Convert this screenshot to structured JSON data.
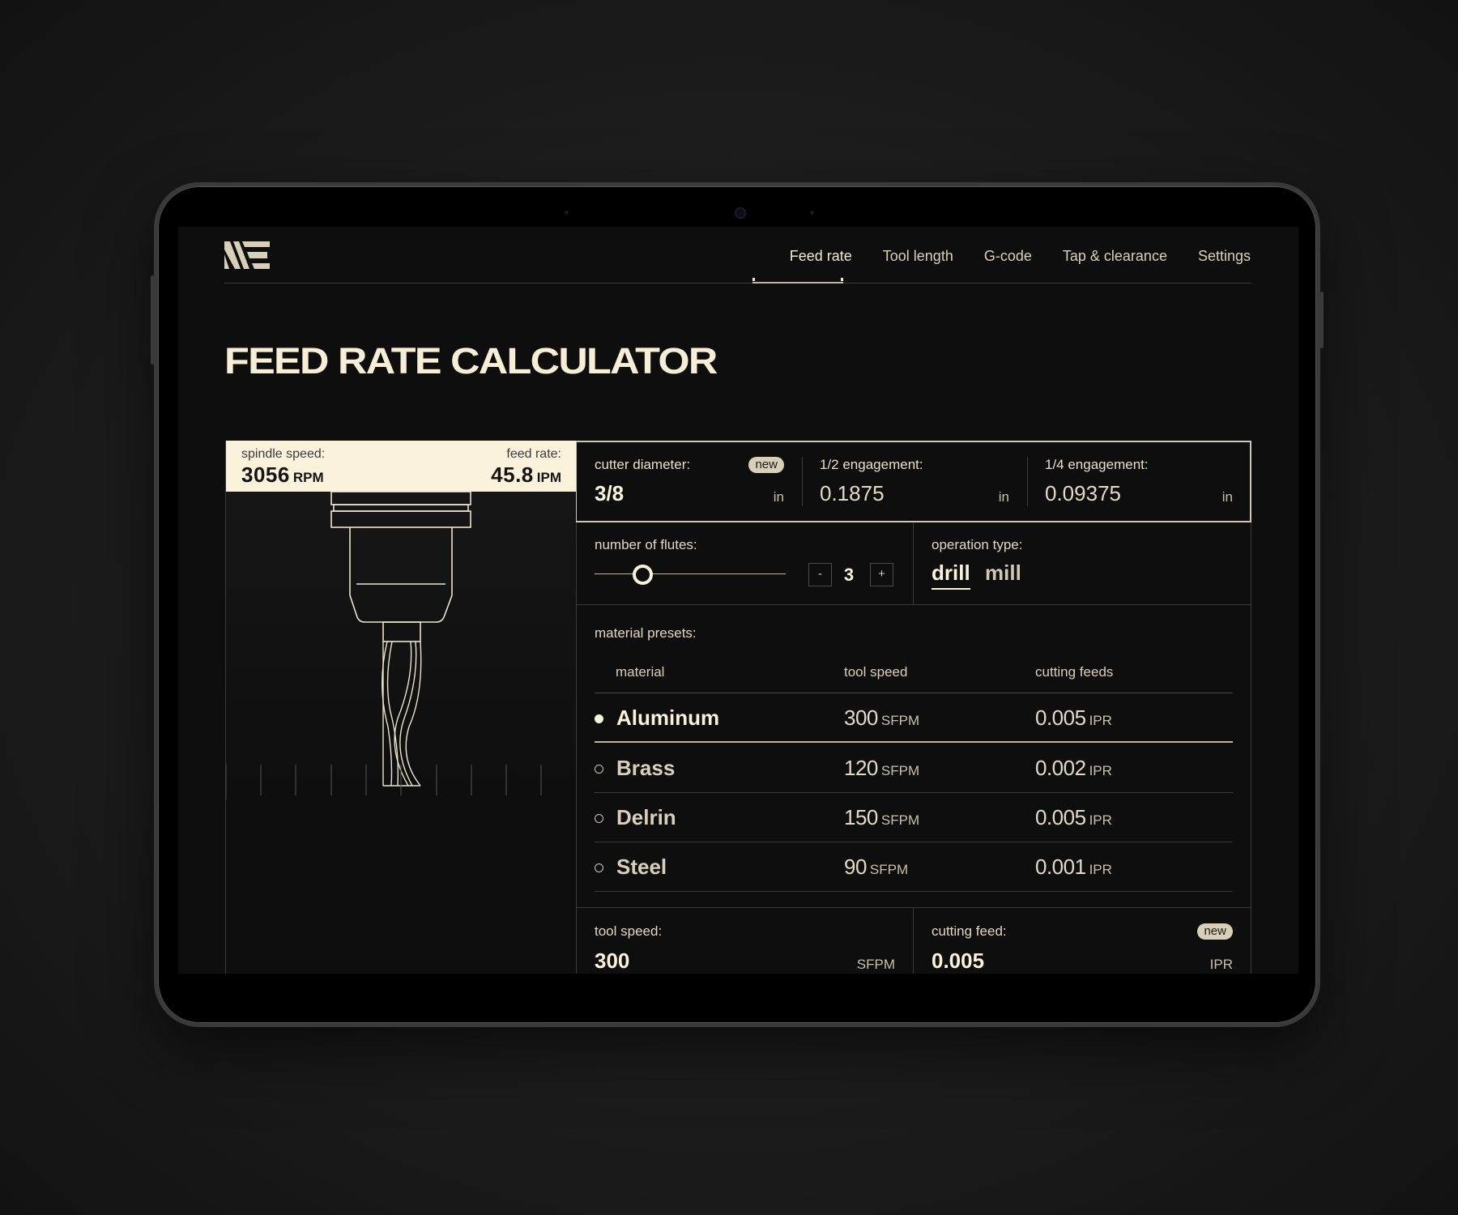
{
  "nav": {
    "items": [
      {
        "label": "Feed rate",
        "active": true
      },
      {
        "label": "Tool length",
        "active": false
      },
      {
        "label": "G-code",
        "active": false
      },
      {
        "label": "Tap & clearance",
        "active": false
      },
      {
        "label": "Settings",
        "active": false
      }
    ]
  },
  "page": {
    "title": "FEED RATE CALCULATOR"
  },
  "readout": {
    "spindle_label": "spindle speed:",
    "spindle_value": "3056",
    "spindle_unit": "RPM",
    "feed_label": "feed rate:",
    "feed_value": "45.8",
    "feed_unit": "IPM"
  },
  "inputs": {
    "cutter_diameter": {
      "label": "cutter diameter:",
      "value": "3/8",
      "unit": "in",
      "badge": "new"
    },
    "half_engagement": {
      "label": "1/2 engagement:",
      "value": "0.1875",
      "unit": "in"
    },
    "quarter_engagement": {
      "label": "1/4 engagement:",
      "value": "0.09375",
      "unit": "in"
    },
    "flutes": {
      "label": "number of flutes:",
      "value": "3",
      "minus": "-",
      "plus": "+",
      "slider_fraction": 0.25
    },
    "operation": {
      "label": "operation type:",
      "options": [
        "drill",
        "mill"
      ],
      "selected": "drill"
    }
  },
  "presets": {
    "label": "material presets:",
    "columns": [
      "material",
      "tool speed",
      "cutting feeds"
    ],
    "rows": [
      {
        "material": "Aluminum",
        "speed": "300",
        "speed_unit": "SFPM",
        "feed": "0.005",
        "feed_unit": "IPR",
        "selected": true
      },
      {
        "material": "Brass",
        "speed": "120",
        "speed_unit": "SFPM",
        "feed": "0.002",
        "feed_unit": "IPR",
        "selected": false
      },
      {
        "material": "Delrin",
        "speed": "150",
        "speed_unit": "SFPM",
        "feed": "0.005",
        "feed_unit": "IPR",
        "selected": false
      },
      {
        "material": "Steel",
        "speed": "90",
        "speed_unit": "SFPM",
        "feed": "0.001",
        "feed_unit": "IPR",
        "selected": false
      }
    ]
  },
  "outputs": {
    "tool_speed": {
      "label": "tool speed:",
      "value": "300",
      "unit": "SFPM"
    },
    "cutting_feed": {
      "label": "cutting feed:",
      "value": "0.005",
      "unit": "IPR",
      "badge": "new"
    }
  },
  "colors": {
    "accent": "#fbf2dc",
    "background": "#0e0e0e",
    "line": "#3a3a3a"
  }
}
